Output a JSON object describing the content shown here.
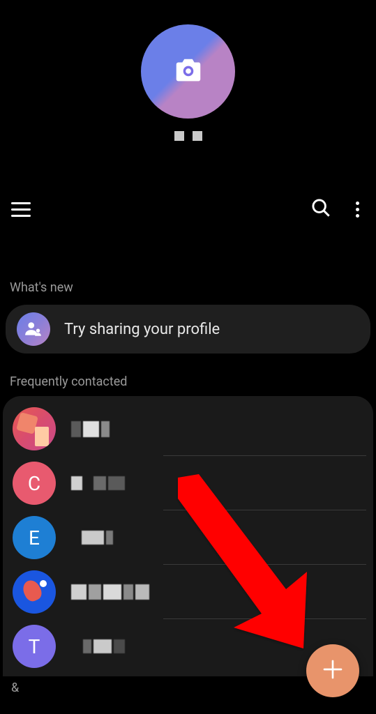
{
  "sections": {
    "whats_new_header": "What's new",
    "whats_new_text": "Try sharing your profile",
    "frequently_header": "Frequently contacted",
    "letter_group": "&"
  },
  "contacts": [
    {
      "initial": "",
      "avatar_type": "image"
    },
    {
      "initial": "C",
      "avatar_type": "letter"
    },
    {
      "initial": "E",
      "avatar_type": "letter"
    },
    {
      "initial": "",
      "avatar_type": "pong"
    },
    {
      "initial": "T",
      "avatar_type": "letter"
    }
  ]
}
